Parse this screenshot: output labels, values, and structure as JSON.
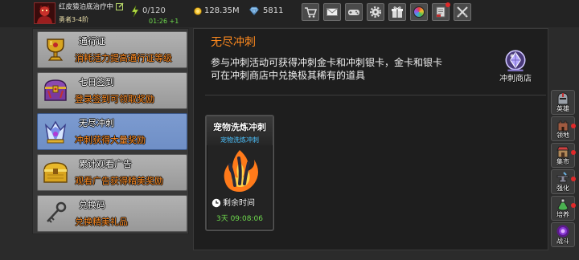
{
  "player": {
    "name": "红皮猿泊底治疗中",
    "rank": "勇者3-4阶",
    "avatar_icon": "player-portrait-icon"
  },
  "energy": {
    "value": "0/120",
    "regen_timer": "01:26 +1",
    "icon": "lightning-icon"
  },
  "currencies": {
    "gold": {
      "value": "128.35M",
      "icon": "gold-coin-icon"
    },
    "gems": {
      "value": "5811",
      "icon": "gem-icon"
    }
  },
  "toolbar": [
    {
      "icon": "shop-cart-icon",
      "badge": false
    },
    {
      "icon": "mail-icon",
      "badge": false
    },
    {
      "icon": "gamepad-icon",
      "badge": false
    },
    {
      "icon": "settings-gear-icon",
      "badge": false
    },
    {
      "icon": "gift-icon",
      "badge": false
    },
    {
      "icon": "color-wheel-icon",
      "badge": false
    },
    {
      "icon": "notice-scroll-icon",
      "badge": true
    },
    {
      "icon": "crossed-swords-icon",
      "badge": false
    }
  ],
  "menu": {
    "items": [
      {
        "title": "通行证",
        "subtitle": "消耗活力提高通行证等级",
        "icon": "golden-goblet-icon",
        "selected": false
      },
      {
        "title": "七日签到",
        "subtitle": "登录签到可领取奖励",
        "icon": "purple-chest-icon",
        "selected": false
      },
      {
        "title": "无尽冲刺",
        "subtitle": "冲刺获得大量奖励",
        "icon": "crystal-crown-icon",
        "selected": true
      },
      {
        "title": "累计观看广告",
        "subtitle": "观看广告获得精美奖励",
        "icon": "golden-chest-icon",
        "selected": false
      },
      {
        "title": "兑换码",
        "subtitle": "兑换精美礼品",
        "icon": "key-icon",
        "selected": false
      }
    ]
  },
  "event": {
    "title": "无尽冲刺",
    "description_lines": [
      "参与冲刺活动可获得冲刺金卡和冲刺银卡，金卡和银卡",
      "可在冲刺商店中兑换极其稀有的道具"
    ],
    "shop_label": "冲刺商店",
    "shop_icon": "crystal-orb-icon"
  },
  "sprint_card": {
    "title": "宠物洗炼冲刺",
    "subtitle": "宠物洗炼冲刺",
    "image": "flame-claw-icon",
    "remaining_label": "剩余时间",
    "remaining_value": "3天 09:08:06"
  },
  "side_nav": [
    {
      "label": "英雄",
      "icon": "helmet-icon",
      "badge": false
    },
    {
      "label": "领地",
      "icon": "castle-icon",
      "badge": true
    },
    {
      "label": "集市",
      "icon": "market-stall-icon",
      "badge": true
    },
    {
      "label": "强化",
      "icon": "anvil-icon",
      "badge": true
    },
    {
      "label": "培养",
      "icon": "potion-icon",
      "badge": true
    },
    {
      "label": "战斗",
      "icon": "portal-icon",
      "badge": false
    }
  ],
  "colors": {
    "accent_orange": "#ff8a1e",
    "timer_green": "#6fdc4e",
    "selected_blue": "#6f8fc6",
    "card_subtitle_cyan": "#4cc3ff",
    "badge_red": "#e02a2a"
  }
}
